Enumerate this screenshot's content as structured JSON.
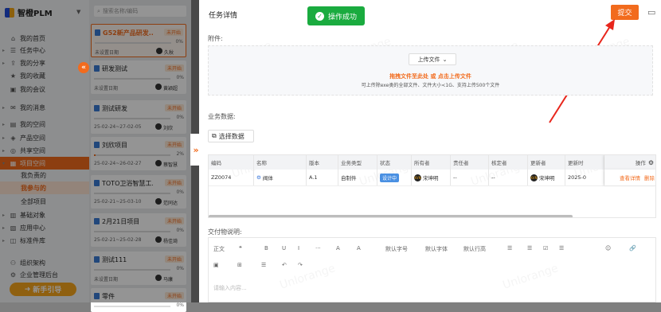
{
  "app": {
    "logo_text": "智橙PLM"
  },
  "sidebar": {
    "items": [
      {
        "label": "我的首页",
        "icon": "home-icon",
        "glyph": "⌂"
      },
      {
        "label": "任务中心",
        "icon": "task-icon",
        "glyph": "☰"
      },
      {
        "label": "我的分享",
        "icon": "share-icon",
        "glyph": "⇪"
      },
      {
        "label": "我的收藏",
        "icon": "star-icon",
        "glyph": "★"
      },
      {
        "label": "我的会议",
        "icon": "meeting-icon",
        "glyph": "▣"
      },
      {
        "label": "我的消息",
        "icon": "message-icon",
        "glyph": "✉"
      },
      {
        "label": "我的空间",
        "icon": "user-space-icon",
        "glyph": "▤"
      },
      {
        "label": "产品空间",
        "icon": "product-icon",
        "glyph": "◈"
      },
      {
        "label": "共享空间",
        "icon": "shared-icon",
        "glyph": "◎"
      },
      {
        "label": "项目空间",
        "icon": "project-icon",
        "glyph": "▦"
      },
      {
        "label": "基础对象",
        "icon": "object-icon",
        "glyph": "▥"
      },
      {
        "label": "应用中心",
        "icon": "app-icon",
        "glyph": "▧"
      },
      {
        "label": "标准件库",
        "icon": "library-icon",
        "glyph": "◫"
      },
      {
        "label": "组织架构",
        "icon": "org-icon",
        "glyph": "⚇"
      },
      {
        "label": "企业管理后台",
        "icon": "admin-icon",
        "glyph": "⚙"
      }
    ],
    "subitems": [
      {
        "label": "我负责的"
      },
      {
        "label": "我参与的"
      },
      {
        "label": "全部项目"
      }
    ],
    "guide_label": "新手引导"
  },
  "project_list": {
    "search_placeholder": "搜索名称/编码",
    "cards": [
      {
        "title": "G52新产品研发...",
        "status": "未开始",
        "progress": 0,
        "progress_text": "0%",
        "date": "未设置日期",
        "owner": "久秋"
      },
      {
        "title": "研发测试",
        "status": "未开始",
        "progress": 0,
        "progress_text": "0%",
        "date": "未设置日期",
        "owner": "黄颖超"
      },
      {
        "title": "测试研发",
        "status": "未开始",
        "progress": 0,
        "progress_text": "0%",
        "date": "25-02-24~27-02-05",
        "owner": "刘欣"
      },
      {
        "title": "刘欣项目",
        "status": "未开始",
        "progress": 2,
        "progress_text": "2%",
        "date": "25-02-24~26-02-27",
        "owner": "蔡智慧"
      },
      {
        "title": "TOTO卫浴智慧工...",
        "status": "未开始",
        "progress": 0,
        "progress_text": "0%",
        "date": "25-02-21~25-03-10",
        "owner": "范同达"
      },
      {
        "title": "2月21日项目",
        "status": "未开始",
        "progress": 0,
        "progress_text": "0%",
        "date": "25-02-21~25-02-28",
        "owner": "杨佳琦"
      },
      {
        "title": "测试111",
        "status": "未开始",
        "progress": 0,
        "progress_text": "0%",
        "date": "未设置日期",
        "owner": "马康"
      },
      {
        "title": "零件",
        "status": "未开始",
        "progress": 0,
        "progress_text": "0%",
        "date": "",
        "owner": ""
      }
    ]
  },
  "drawer": {
    "title": "任务详情",
    "toast": "操作成功",
    "submit_label": "提交",
    "attachment_label": "附件:",
    "upload_button": "上传文件",
    "upload_hint": "拖拽文件至此处 或 点击上传文件",
    "upload_sub": "可上传除exe类的全部文件、文件大小<1G、支持上传500个文件",
    "business_label": "业务数据:",
    "select_data_label": "选择数据",
    "table": {
      "headers": [
        "编码",
        "名称",
        "版本",
        "业务类型",
        "状态",
        "所有者",
        "责任者",
        "核定者",
        "更新者",
        "更新时",
        "操作"
      ],
      "rows": [
        {
          "code": "ZZ0074",
          "name": "阀体",
          "version": "A.1",
          "type": "自制件",
          "status": "设计中",
          "owner_badge": "KVN",
          "owner": "宋坤明",
          "responsible": "--",
          "approver": "--",
          "updater_badge": "KVN",
          "updater": "宋坤明",
          "updated": "2025-0",
          "view": "查看详情",
          "delete": "删除"
        }
      ]
    },
    "deliverable_label": "交付物说明:",
    "editor": {
      "toolbar_row1": [
        "正文",
        "❝",
        "B",
        "U",
        "I",
        "···",
        "A",
        "A",
        "默认字号",
        "默认字体",
        "默认行高",
        "☰",
        "☰",
        "☑",
        "☰",
        "☺",
        "🔗"
      ],
      "toolbar_row2": [
        "▣",
        "⊞",
        "☰",
        "↶",
        "↷"
      ],
      "placeholder": "请输入内容..."
    },
    "watermark": "Unlorange"
  },
  "colors": {
    "accent": "#f26b1d",
    "success": "#1aab3f",
    "status_blue": "#4a90e2"
  }
}
